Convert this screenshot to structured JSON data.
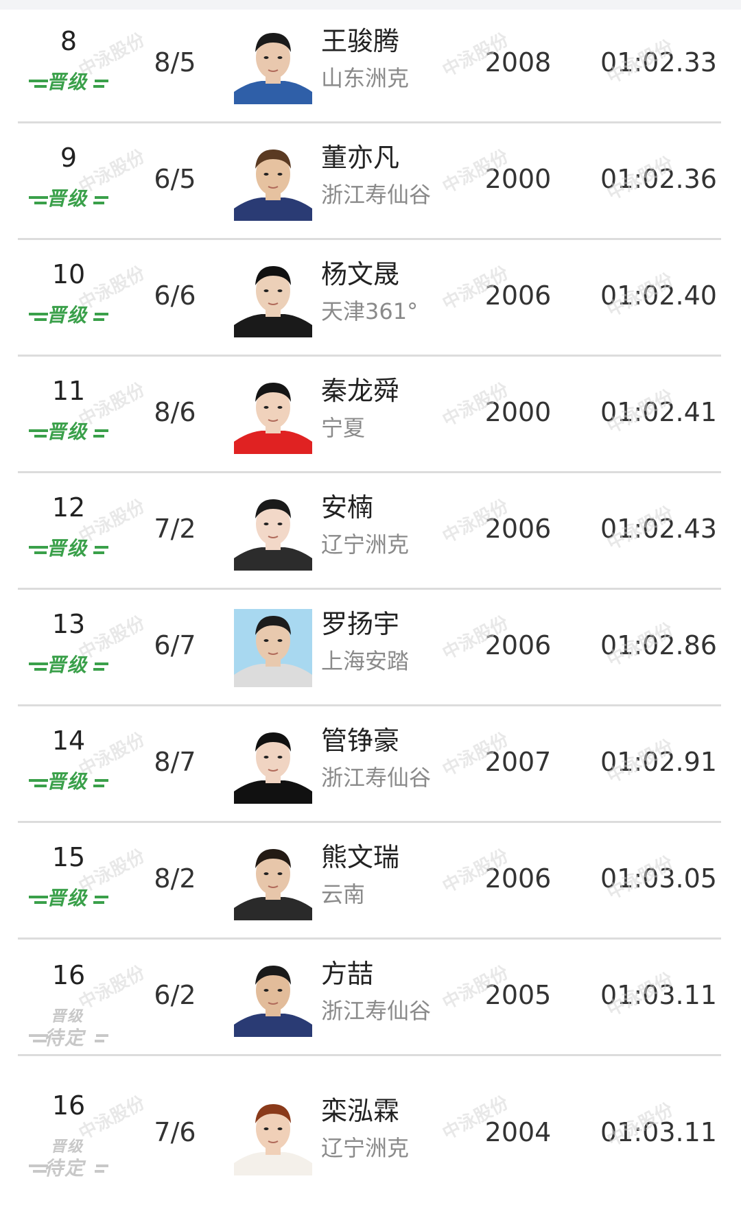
{
  "watermark_text": "中泳股份",
  "colors": {
    "advance": "#3aa04a",
    "pending": "#c8c8c8",
    "divider": "#dcdcdc",
    "team": "#8a8a8a"
  },
  "rows": [
    {
      "rank": "8",
      "status": "advanced",
      "badge_line1": "晋级",
      "badge_line2": "",
      "lane": "8/5",
      "name": "王骏腾",
      "team": "山东洲克",
      "year": "2008",
      "time": "01:02.33",
      "jersey": "#2f5fa8",
      "skin": "#e9c8ae",
      "hair": "#1a1a1a",
      "bg": "#ffffff"
    },
    {
      "rank": "9",
      "status": "advanced",
      "badge_line1": "晋级",
      "badge_line2": "",
      "lane": "6/5",
      "name": "董亦凡",
      "team": "浙江寿仙谷",
      "year": "2000",
      "time": "01:02.36",
      "jersey": "#2a3b74",
      "skin": "#e6c2a0",
      "hair": "#5a3a22",
      "bg": "#ffffff"
    },
    {
      "rank": "10",
      "status": "advanced",
      "badge_line1": "晋级",
      "badge_line2": "",
      "lane": "6/6",
      "name": "杨文晟",
      "team": "天津361°",
      "year": "2006",
      "time": "01:02.40",
      "jersey": "#1a1a1a",
      "skin": "#ecd0b8",
      "hair": "#111111",
      "bg": "#ffffff"
    },
    {
      "rank": "11",
      "status": "advanced",
      "badge_line1": "晋级",
      "badge_line2": "",
      "lane": "8/6",
      "name": "秦龙舜",
      "team": "宁夏",
      "year": "2000",
      "time": "01:02.41",
      "jersey": "#e02222",
      "skin": "#f0d2bc",
      "hair": "#151515",
      "bg": "#ffffff"
    },
    {
      "rank": "12",
      "status": "advanced",
      "badge_line1": "晋级",
      "badge_line2": "",
      "lane": "7/2",
      "name": "安楠",
      "team": "辽宁洲克",
      "year": "2006",
      "time": "01:02.43",
      "jersey": "#2c2c2c",
      "skin": "#f2d8c8",
      "hair": "#1a1a1a",
      "bg": "#ffffff"
    },
    {
      "rank": "13",
      "status": "advanced",
      "badge_line1": "晋级",
      "badge_line2": "",
      "lane": "6/7",
      "name": "罗扬宇",
      "team": "上海安踏",
      "year": "2006",
      "time": "01:02.86",
      "jersey": "#dcdcdc",
      "skin": "#e8c9ae",
      "hair": "#1c1c1c",
      "bg": "#a8d8f0"
    },
    {
      "rank": "14",
      "status": "advanced",
      "badge_line1": "晋级",
      "badge_line2": "",
      "lane": "8/7",
      "name": "管铮豪",
      "team": "浙江寿仙谷",
      "year": "2007",
      "time": "01:02.91",
      "jersey": "#111111",
      "skin": "#f0d4c2",
      "hair": "#111111",
      "bg": "#ffffff"
    },
    {
      "rank": "15",
      "status": "advanced",
      "badge_line1": "晋级",
      "badge_line2": "",
      "lane": "8/2",
      "name": "熊文瑞",
      "team": "云南",
      "year": "2006",
      "time": "01:03.05",
      "jersey": "#2a2a2a",
      "skin": "#e7c6aa",
      "hair": "#231a14",
      "bg": "#ffffff"
    },
    {
      "rank": "16",
      "status": "pending",
      "badge_line1": "晋级",
      "badge_line2": "待定",
      "lane": "6/2",
      "name": "方喆",
      "team": "浙江寿仙谷",
      "year": "2005",
      "time": "01:03.11",
      "jersey": "#2a3b74",
      "skin": "#e2bc9a",
      "hair": "#1a1a1a",
      "bg": "#ffffff"
    },
    {
      "rank": "16",
      "status": "pending",
      "badge_line1": "晋级",
      "badge_line2": "待定",
      "lane": "7/6",
      "name": "栾泓霖",
      "team": "辽宁洲克",
      "year": "2004",
      "time": "01:03.11",
      "jersey": "#f4f0ea",
      "skin": "#f0d0b8",
      "hair": "#8a3a1a",
      "bg": "#ffffff"
    }
  ]
}
